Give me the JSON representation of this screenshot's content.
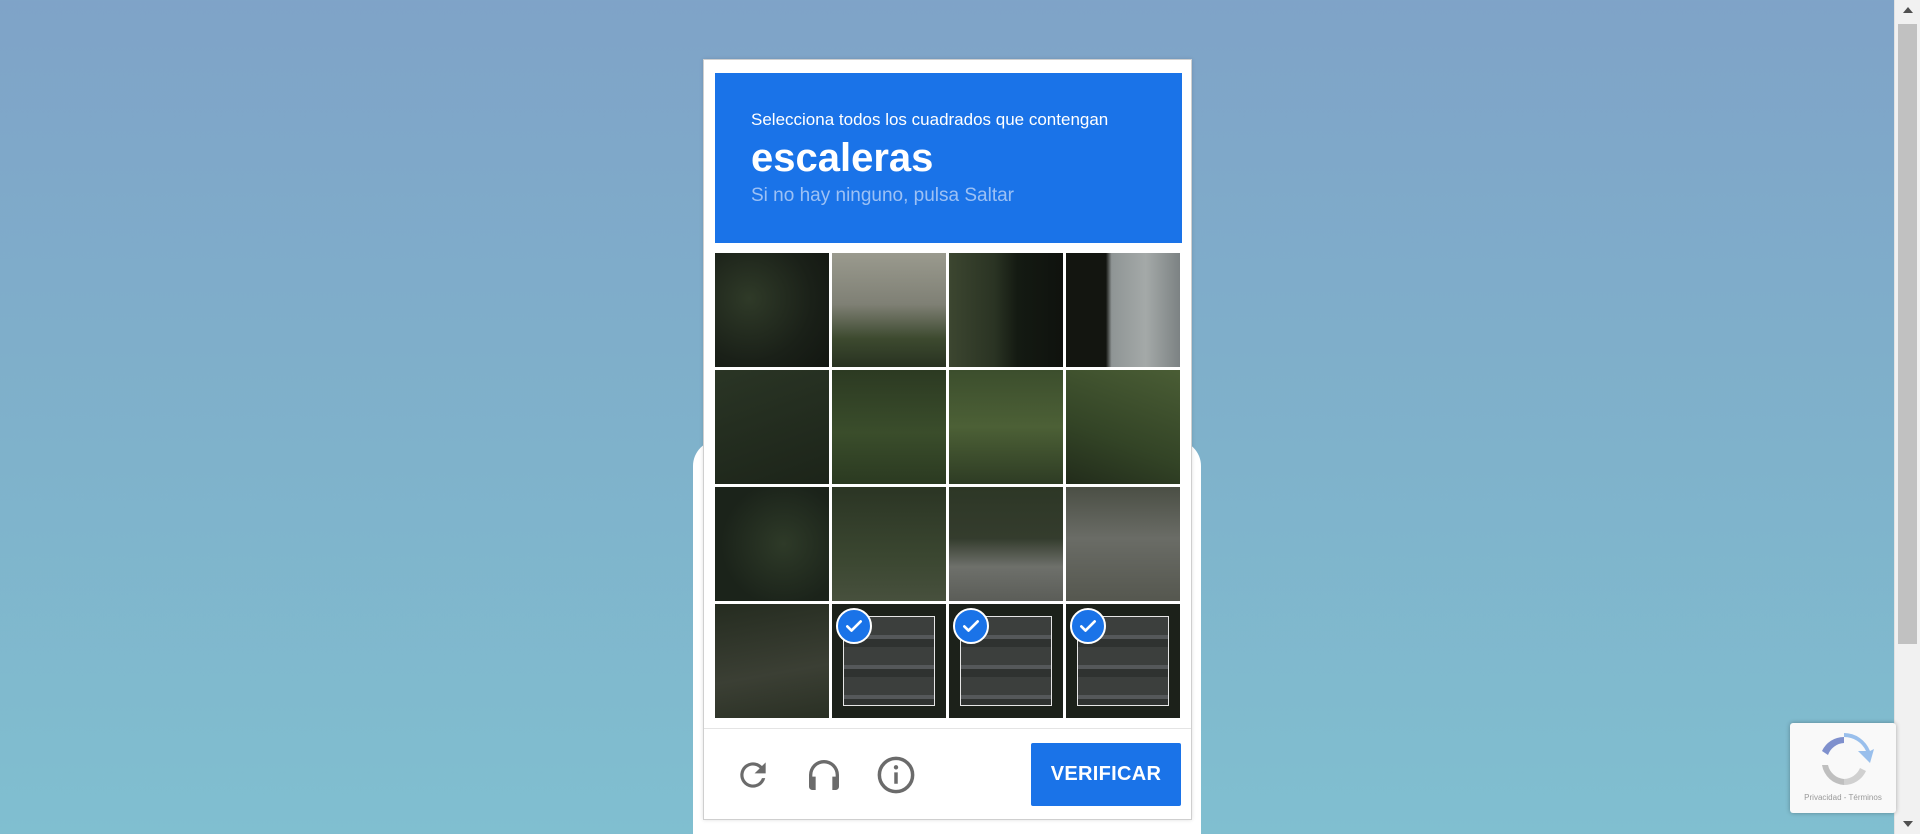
{
  "challenge": {
    "instruction": "Selecciona todos los cuadrados que contengan",
    "keyword": "escaleras",
    "hint": "Si no hay ninguno, pulsa Saltar",
    "tiles": [
      {
        "texture": "t-dark",
        "selected": false
      },
      {
        "texture": "t-fence",
        "selected": false
      },
      {
        "texture": "t-trees",
        "selected": false
      },
      {
        "texture": "t-house",
        "selected": false
      },
      {
        "texture": "t-grass1",
        "selected": false
      },
      {
        "texture": "t-grass2",
        "selected": false
      },
      {
        "texture": "t-grass3",
        "selected": false
      },
      {
        "texture": "t-grass4",
        "selected": false
      },
      {
        "texture": "t-ivy",
        "selected": false
      },
      {
        "texture": "t-step1",
        "selected": false
      },
      {
        "texture": "t-step2",
        "selected": false
      },
      {
        "texture": "t-step3",
        "selected": false
      },
      {
        "texture": "t-path",
        "selected": false
      },
      {
        "texture": "t-stairs",
        "selected": true
      },
      {
        "texture": "t-stairs",
        "selected": true
      },
      {
        "texture": "t-stairs",
        "selected": true
      }
    ],
    "footer": {
      "reload_icon": "reload-icon",
      "audio_icon": "headphones-icon",
      "info_icon": "info-icon",
      "verify_label": "VERIFICAR"
    }
  },
  "badge": {
    "logo_icon": "recaptcha-logo-icon",
    "links": "Privacidad - Términos"
  },
  "colors": {
    "accent": "#1a73e8",
    "hint": "#9cc1f5",
    "background_top": "#7fa3c8",
    "background_bottom": "#80bfd0"
  }
}
